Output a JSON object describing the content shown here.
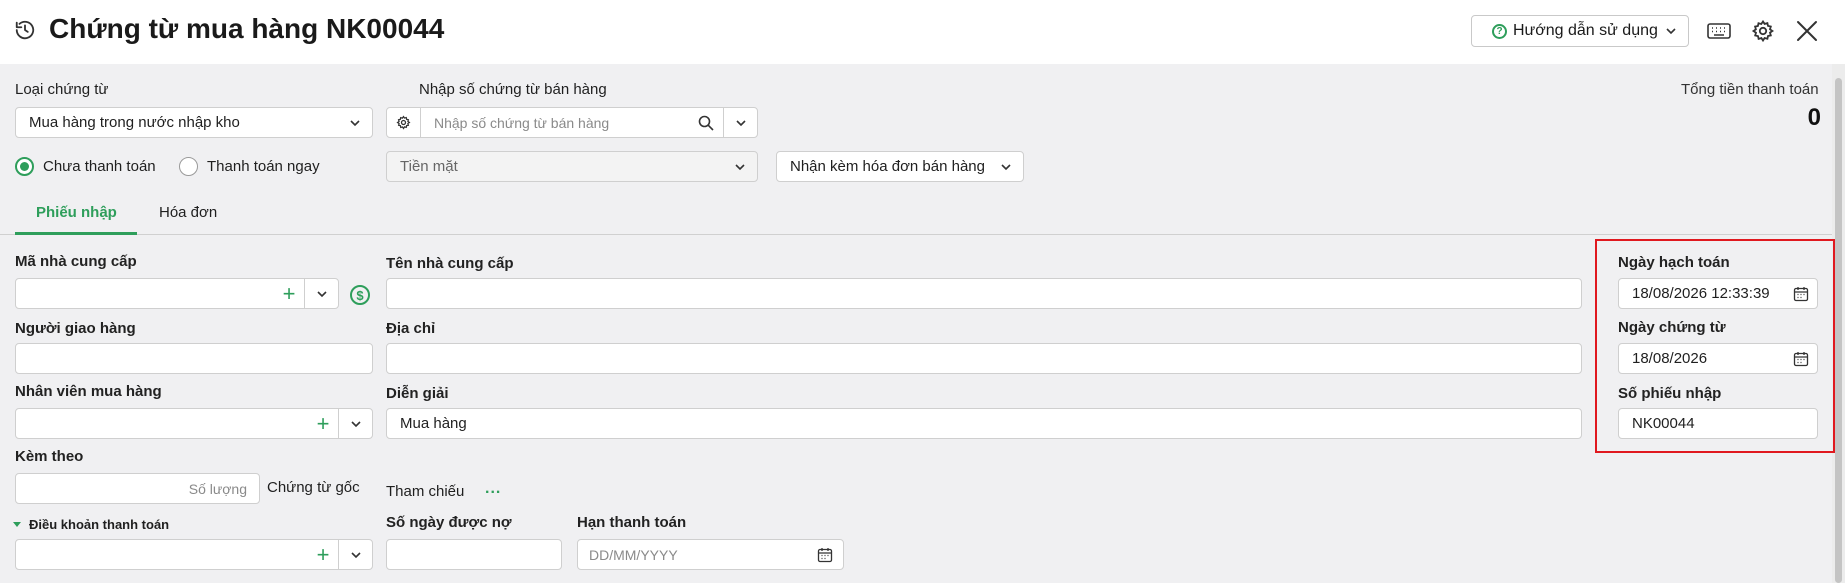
{
  "header": {
    "title": "Chứng từ mua hàng NK00044",
    "help_label": "Hướng dẫn sử dụng",
    "icons": [
      "history-icon",
      "keyboard-icon",
      "gear-icon",
      "close-icon"
    ]
  },
  "top_form": {
    "voucher_type_label": "Loại chứng từ",
    "voucher_type_value": "Mua hàng trong nước nhập kho",
    "sales_doc_label": "Nhập số chứng từ bán hàng",
    "sales_doc_placeholder": "Nhập số chứng từ bán hàng",
    "payment_options": [
      "Chưa thanh toán",
      "Thanh toán ngay"
    ],
    "payment_selected": "Chưa thanh toán",
    "payment_method": "Tiền mặt",
    "invoice_option": "Nhận kèm hóa đơn bán hàng",
    "total_label": "Tổng tiền thanh toán",
    "total_value": "0"
  },
  "tabs": [
    {
      "label": "Phiếu nhập",
      "active": true
    },
    {
      "label": "Hóa đơn",
      "active": false
    }
  ],
  "form": {
    "supplier_code_label": "Mã nhà cung cấp",
    "supplier_name_label": "Tên nhà cung cấp",
    "deliverer_label": "Người giao hàng",
    "address_label": "Địa chỉ",
    "purchaser_label": "Nhân viên mua hàng",
    "description_label": "Diễn giải",
    "description_value": "Mua hàng",
    "attached_label": "Kèm theo",
    "quantity_placeholder": "Số lượng",
    "original_docs_label": "Chứng từ gốc",
    "reference_label": "Tham chiếu",
    "reference_more": "...",
    "payment_terms_label": "Điều khoản thanh toán",
    "credit_days_label": "Số ngày được nợ",
    "due_date_label": "Hạn thanh toán",
    "due_date_placeholder": "DD/MM/YYYY"
  },
  "side": {
    "posting_date_label": "Ngày hạch toán",
    "posting_date_value": "18/08/2026 12:33:39",
    "doc_date_label": "Ngày chứng từ",
    "doc_date_value": "18/08/2026",
    "receipt_no_label": "Số phiếu nhập",
    "receipt_no_value": "NK00044"
  },
  "colors": {
    "accent": "#2e9e5b",
    "highlight": "#e0191f"
  }
}
